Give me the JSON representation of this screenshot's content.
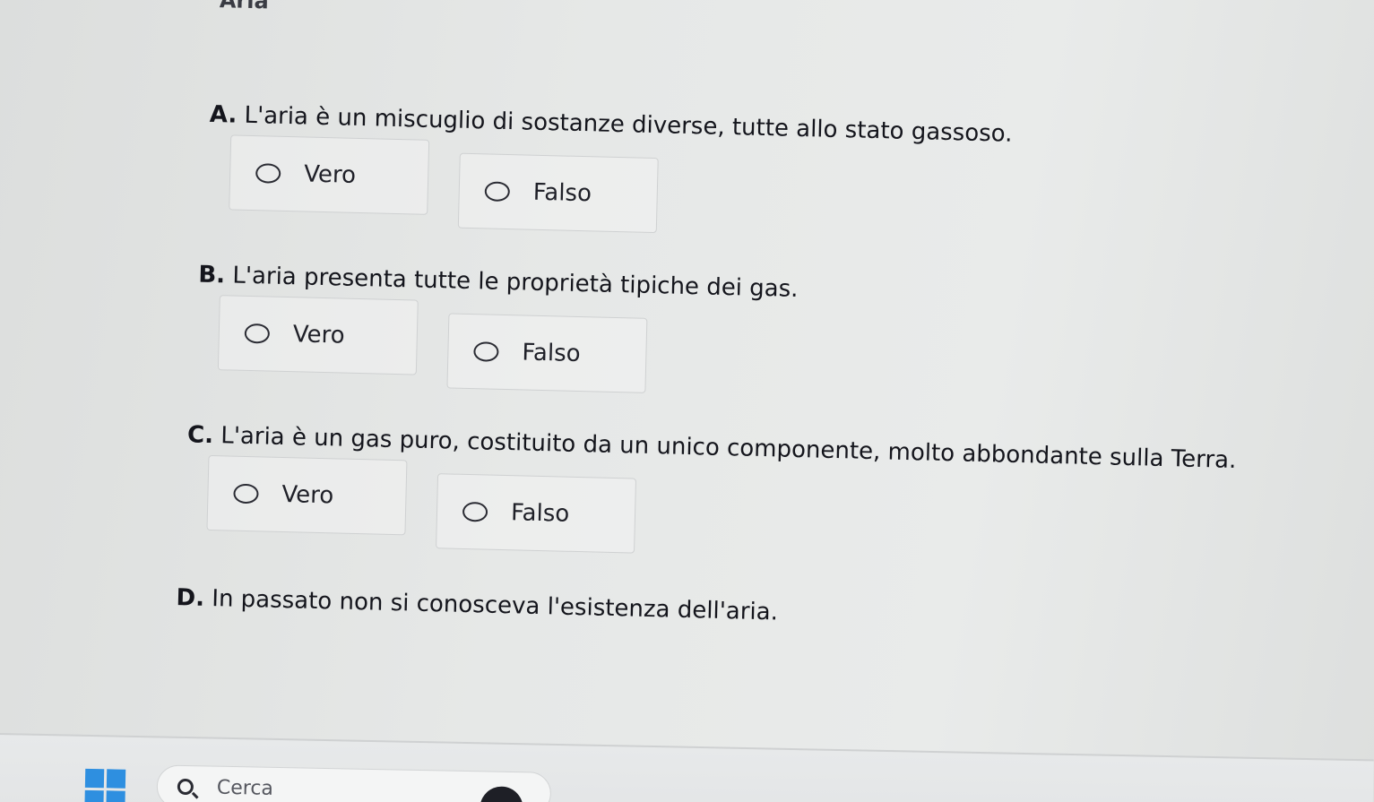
{
  "page": {
    "title": "Aria"
  },
  "questions": [
    {
      "letter": "A.",
      "text": "L'aria è un miscuglio di sostanze diverse, tutte allo stato gassoso.",
      "options": [
        "Vero",
        "Falso"
      ]
    },
    {
      "letter": "B.",
      "text": "L'aria presenta tutte le proprietà tipiche dei gas.",
      "options": [
        "Vero",
        "Falso"
      ]
    },
    {
      "letter": "C.",
      "text": "L'aria è un gas puro, costituito da un unico componente, molto abbondante sulla Terra.",
      "options": [
        "Vero",
        "Falso"
      ]
    },
    {
      "letter": "D.",
      "text": "In passato non si conosceva l'esistenza dell'aria.",
      "options": []
    }
  ],
  "taskbar": {
    "search_placeholder": "Cerca",
    "start_icon": "windows-start-icon",
    "search_icon": "search-icon",
    "accent_color": "#2e8fe0"
  }
}
